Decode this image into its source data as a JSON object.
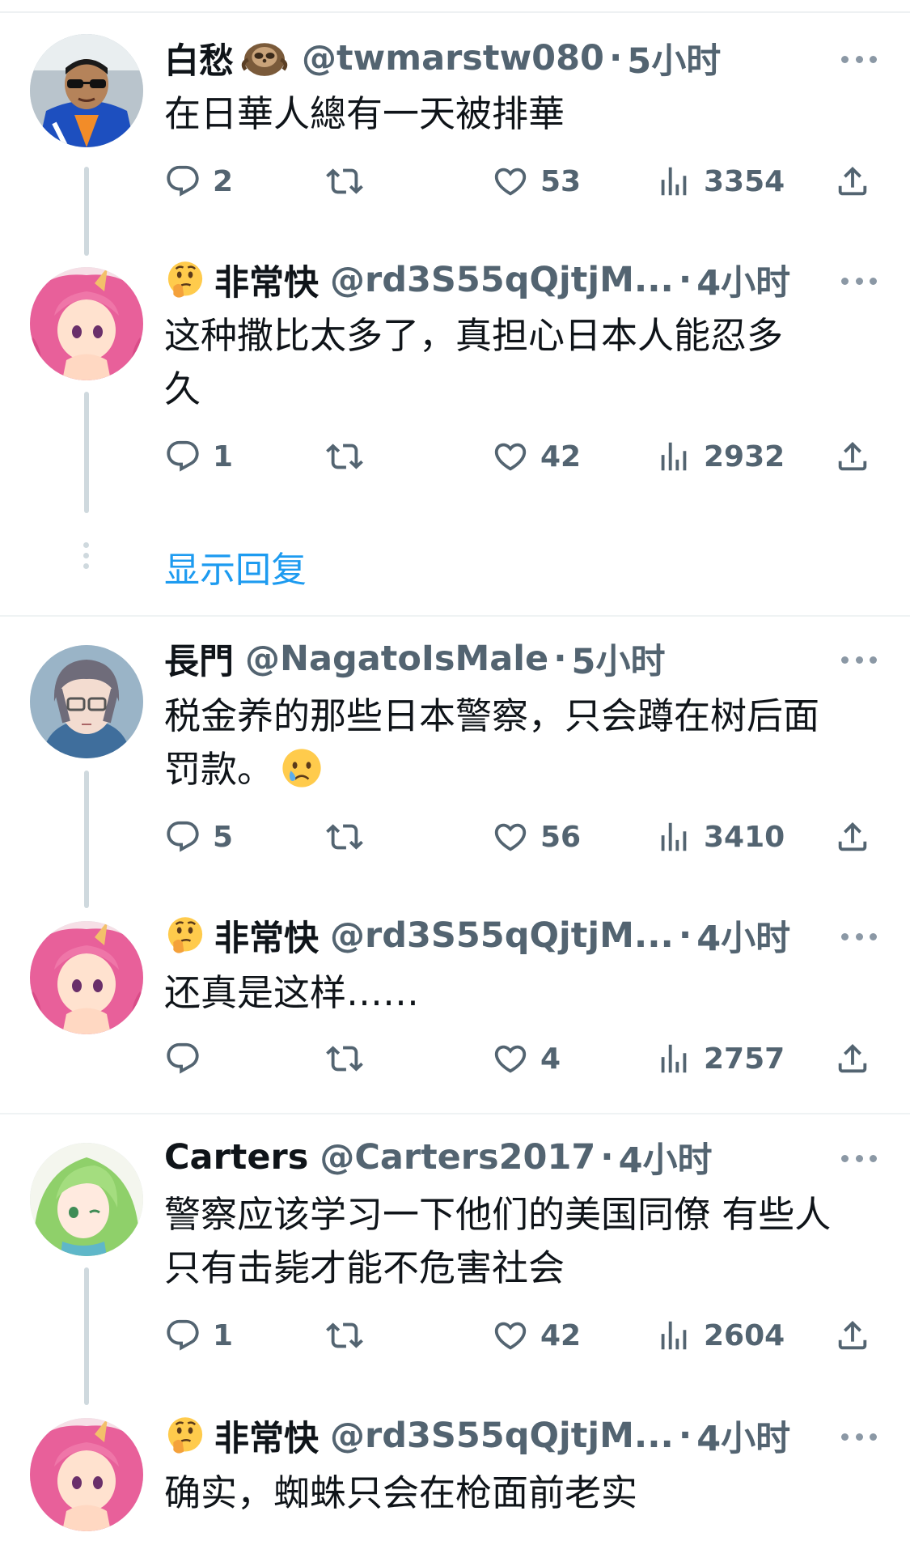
{
  "tweets": [
    {
      "name": "白愁",
      "handle": "@twmarstw080",
      "separator": "·",
      "time": "5小时",
      "text_lines": [
        "在日華人總有一天被排華"
      ],
      "reply_count": "2",
      "retweet_count": "",
      "like_count": "53",
      "view_count": "3354",
      "avatar": "man-with-sunglasses"
    },
    {
      "name": "非常快",
      "handle": "@rd3S55qQjtjM...",
      "separator": "·",
      "time": "4小时",
      "text_lines": [
        "这种撒比太多了，真担心日本人能忍多",
        "久"
      ],
      "reply_count": "1",
      "retweet_count": "",
      "like_count": "42",
      "view_count": "2932",
      "avatar": "pink-hair-anime"
    },
    {
      "name": "長門",
      "handle": "@NagatoIsMale",
      "separator": "·",
      "time": "5小时",
      "text_lines": [
        "税金养的那些日本警察，只会蹲在树后面",
        "罚款。"
      ],
      "reply_count": "5",
      "retweet_count": "",
      "like_count": "56",
      "view_count": "3410",
      "avatar": "gray-hair-anime-glasses"
    },
    {
      "name": "非常快",
      "handle": "@rd3S55qQjtjM...",
      "separator": "·",
      "time": "4小时",
      "text_lines": [
        "还真是这样……"
      ],
      "reply_count": "",
      "retweet_count": "",
      "like_count": "4",
      "view_count": "2757",
      "avatar": "pink-hair-anime"
    },
    {
      "name": "Carters",
      "handle": "@Carters2017",
      "separator": "·",
      "time": "4小时",
      "text_lines": [
        "警察应该学习一下他们的美国同僚 有些人",
        "只有击毙才能不危害社会"
      ],
      "reply_count": "1",
      "retweet_count": "",
      "like_count": "42",
      "view_count": "2604",
      "avatar": "green-hair-anime"
    },
    {
      "name": "非常快",
      "handle": "@rd3S55qQjtjM...",
      "separator": "·",
      "time": "4小时",
      "text_lines": [
        "确实，蜘蛛只会在枪面前老实"
      ],
      "avatar": "pink-hair-anime"
    }
  ],
  "show_replies_label": "显示回复",
  "icons": [
    "reply-icon",
    "retweet-icon",
    "like-icon",
    "views-icon",
    "share-icon",
    "more-icon",
    "thinking-face-emoji",
    "crying-face-emoji",
    "sloth-emoji"
  ],
  "colors": {
    "link_blue": "#1d9bf0",
    "secondary_text": "#536471",
    "primary_text": "#0f1419",
    "thread_line": "#cfd9de"
  }
}
